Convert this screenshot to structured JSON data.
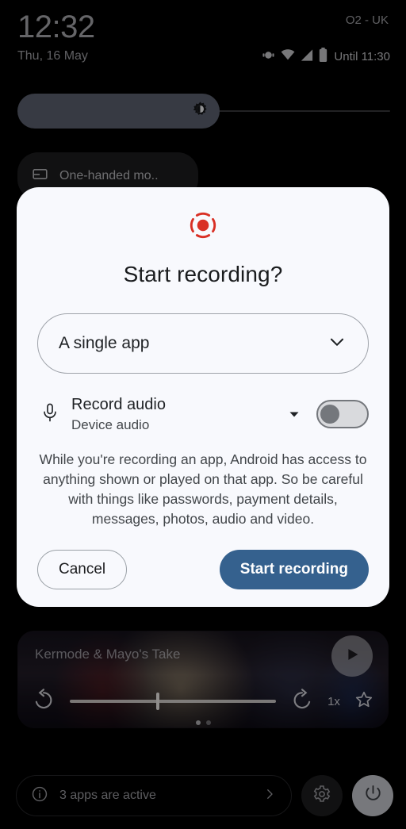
{
  "status_bar": {
    "time": "12:32",
    "date": "Thu, 16 May",
    "carrier": "O2 - UK",
    "battery_status": "Until 11:30",
    "icons": [
      "vibrate-icon",
      "wifi-icon",
      "cellular-signal-icon",
      "battery-icon"
    ]
  },
  "quick_settings": {
    "brightness_icon": "brightness-icon",
    "brightness_percent": 52,
    "tile": {
      "label": "One-handed mo..",
      "icon": "one-handed-mode-icon"
    }
  },
  "dialog": {
    "icon": "screen-record-icon",
    "icon_color": "#d93025",
    "title": "Start recording?",
    "scope_select": {
      "value": "A single app",
      "chevron": "chevron-down-icon"
    },
    "audio": {
      "icon": "microphone-icon",
      "title": "Record audio",
      "subtitle": "Device audio",
      "caret": "caret-down-icon",
      "toggle_state": "off"
    },
    "body": "While you're recording an app, Android has access to anything shown or played on that app. So be careful with things like passwords, payment details, messages, photos, audio and video.",
    "cancel_label": "Cancel",
    "primary_label": "Start recording",
    "primary_color": "#35618e"
  },
  "media_player": {
    "title": "Kermode & Mayo's Take",
    "play_icon": "play-icon",
    "rewind_icon": "rewind-icon",
    "forward_icon": "fast-forward-icon",
    "speed_label": "1x",
    "favorite_icon": "star-outline-icon",
    "progress_percent": 42,
    "page_dots": 2,
    "active_dot_index": 0
  },
  "footer": {
    "info_icon": "info-icon",
    "active_apps_label": "3 apps are active",
    "chevron": "chevron-right-icon",
    "settings_icon": "gear-icon",
    "power_icon": "power-icon"
  }
}
